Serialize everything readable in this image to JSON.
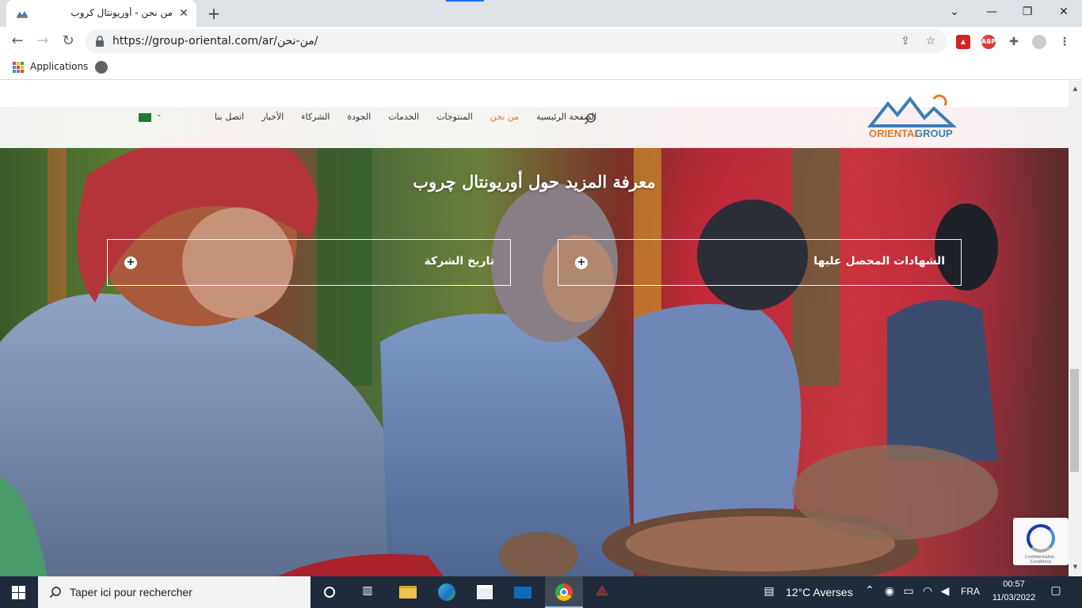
{
  "browser": {
    "tab_title": "من نحن - أوريونتال كروب",
    "url": "https://group-oriental.com/ar/من-نحن/",
    "bookmarks": {
      "apps_label": "Applications"
    },
    "extensions": {
      "adblock_label": "ABP"
    }
  },
  "site": {
    "logo": {
      "part1": "ORIENTAL",
      "part2": "GROUP"
    },
    "nav": [
      {
        "label": "الصفحة الرئيسية",
        "active": false
      },
      {
        "label": "من نحن",
        "active": true
      },
      {
        "label": "المنتوجات",
        "active": false
      },
      {
        "label": "الخدمات",
        "active": false
      },
      {
        "label": "الجودة",
        "active": false
      },
      {
        "label": "الشركاء",
        "active": false
      },
      {
        "label": "الأخبار",
        "active": false
      },
      {
        "label": "اتصل بنا",
        "active": false
      }
    ],
    "accent_color": "#e07a2a",
    "heading": "معرفة المزيد حول أوريونتال چروب",
    "accordion": [
      {
        "label": "الشهادات المحصل عليها"
      },
      {
        "label": "تاريخ الشركة"
      }
    ],
    "recaptcha_text": "Confidentialité - Conditions"
  },
  "taskbar": {
    "search_placeholder": "Taper ici pour rechercher",
    "weather": "12°C  Averses",
    "language": "FRA",
    "time": "00:57",
    "date": "11/03/2022"
  }
}
